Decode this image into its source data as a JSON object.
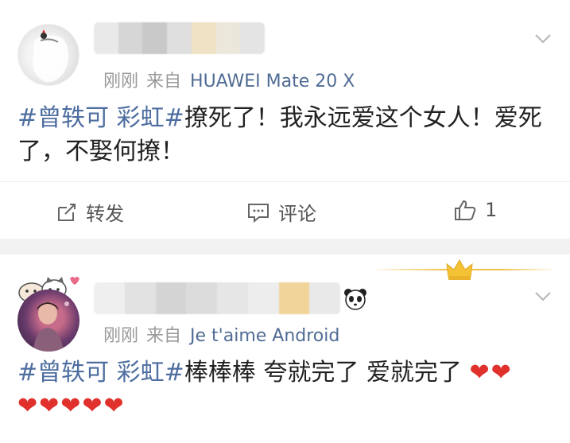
{
  "posts": [
    {
      "time": "刚刚",
      "from": "来自",
      "device": "HUAWEI Mate 20 X",
      "hashtag": "#曾轶可 彩虹#",
      "text": "撩死了！我永远爱这个女人！爱死了，不娶何撩！",
      "actions": {
        "share": "转发",
        "comment": "评论",
        "like_count": "1"
      }
    },
    {
      "time": "刚刚",
      "from": "来自",
      "device": "Je t'aime Android",
      "hashtag": "#曾轶可 彩虹#",
      "text": "棒棒棒 夸就完了 爱就完了",
      "hearts_line1": "❤❤",
      "hearts_line2": "❤❤❤❤❤"
    }
  ],
  "colors": {
    "link": "#4e6ea0",
    "device": "#506c94",
    "meta": "#999999",
    "heart": "#e0312d",
    "background": "#f2f2f2"
  },
  "icons": [
    "chevron-down-icon",
    "share-icon",
    "comment-icon",
    "thumbs-up-icon",
    "panda-icon",
    "crown-icon",
    "heart-icon"
  ]
}
